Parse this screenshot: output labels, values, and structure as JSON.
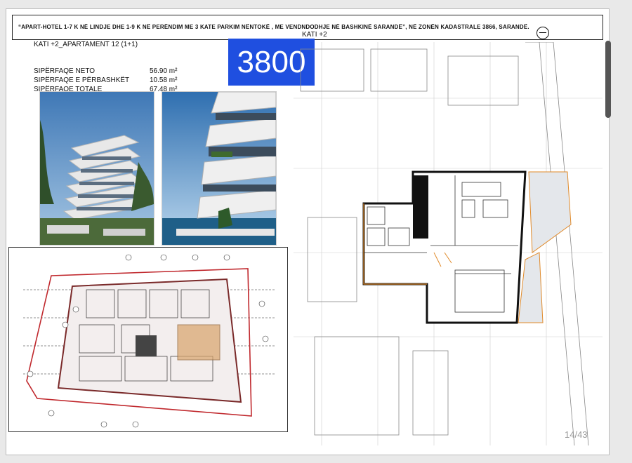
{
  "header": {
    "title": "“APART-HOTEL 1-7 K NË LINDJE DHE 1-9 K NË PERËNDIM ME 3 KATE PARKIM NËNTOKË , ME VENDNDODHJE NË BASHKINË SARANDË”, NË ZONËN KADASTRALE 3866, SARANDË."
  },
  "apartment": {
    "title": "KATI  +2_APARTAMENT 12   (1+1)",
    "areas": [
      {
        "label": "SIPËRFAQE NETO",
        "value": "56.90 m²"
      },
      {
        "label": "SIPËRFAQE E PËRBASHKËT",
        "value": "10.58 m²"
      },
      {
        "label": "SIPËRFAQE TOTALE",
        "value": "67.48 m²"
      }
    ]
  },
  "badge": {
    "text": "3800",
    "color": "#1f4fe0"
  },
  "floor": {
    "label": "KATI  +2"
  },
  "page": {
    "number": "14/43"
  },
  "icons": {
    "compass": "north-arrow-icon"
  }
}
